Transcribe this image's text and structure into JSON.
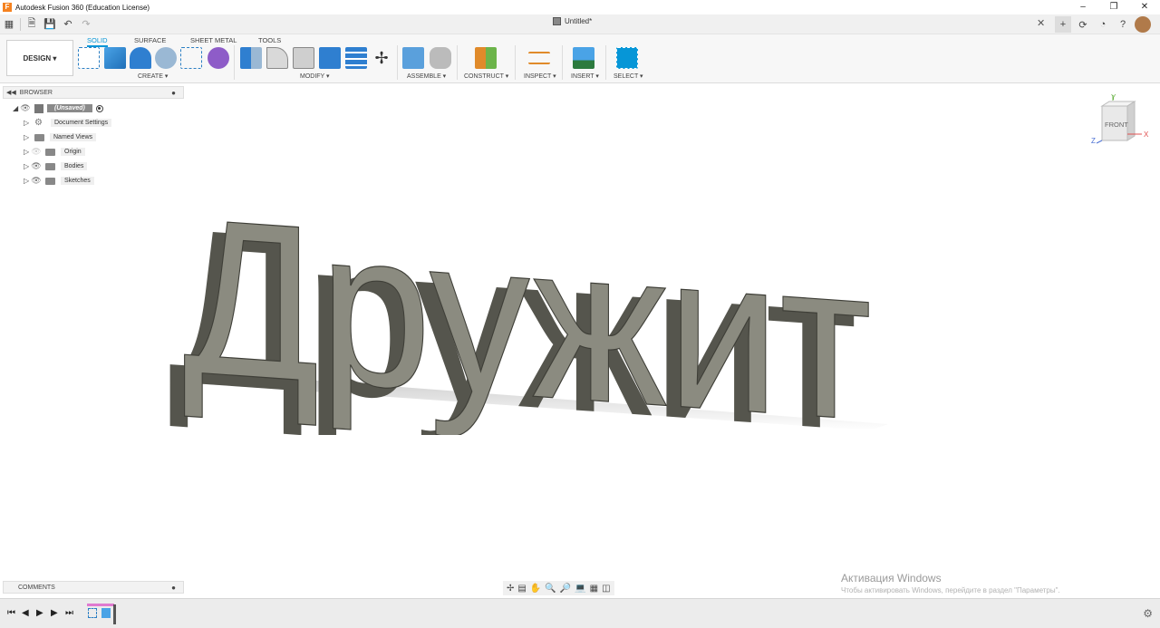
{
  "app": {
    "window_title": "Autodesk Fusion 360 (Education License)",
    "doc_tab": "Untitled*",
    "logo_letter": "F"
  },
  "ribbon": {
    "workspace": "DESIGN ▾",
    "tabs": [
      "SOLID",
      "SURFACE",
      "SHEET METAL",
      "TOOLS"
    ],
    "active_tab": "SOLID",
    "groups": [
      "CREATE ▾",
      "MODIFY ▾",
      "ASSEMBLE ▾",
      "CONSTRUCT ▾",
      "INSPECT ▾",
      "INSERT ▾",
      "SELECT ▾"
    ]
  },
  "browser": {
    "title": "BROWSER",
    "root": "(Unsaved)",
    "items": [
      "Document Settings",
      "Named Views",
      "Origin",
      "Bodies",
      "Sketches"
    ]
  },
  "viewcube": {
    "face": "FRONT",
    "axis_x": "X",
    "axis_y": "Y",
    "axis_z": "Z"
  },
  "model": {
    "text": "Дружит"
  },
  "comments": {
    "label": "COMMENTS"
  },
  "activation": {
    "title": "Активация Windows",
    "subtitle": "Чтобы активировать Windows, перейдите в раздел \"Параметры\"."
  },
  "colors": {
    "accent": "#0696d7",
    "body": "#8b8b80",
    "body_dark": "#55554d"
  }
}
